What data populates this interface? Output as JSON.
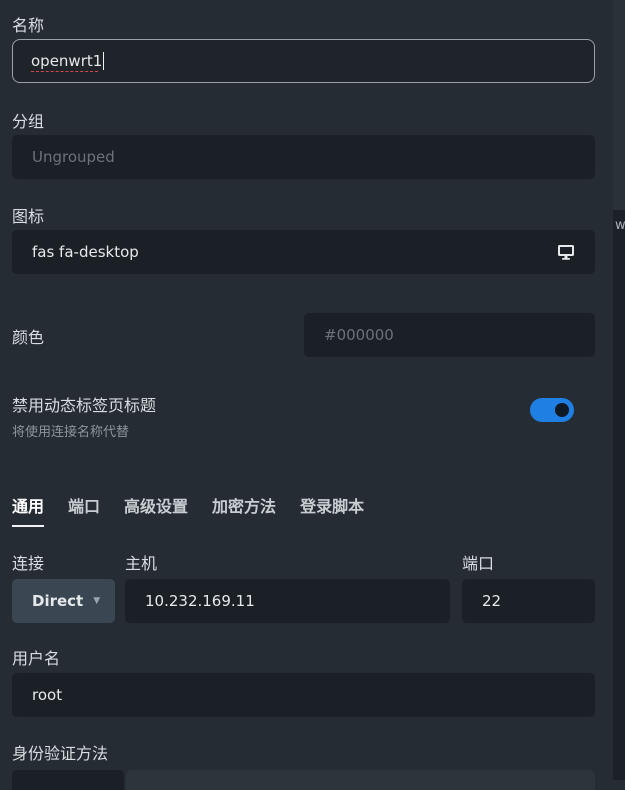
{
  "labels": {
    "name": "名称",
    "group": "分组",
    "icon": "图标",
    "color": "颜色",
    "disable_dynamic_title": "禁用动态标签页标题",
    "disable_dynamic_title_sub": "将使用连接名称代替",
    "connection": "连接",
    "host": "主机",
    "port": "端口",
    "username": "用户名",
    "auth_method": "身份验证方法"
  },
  "fields": {
    "name_value": "openwrt1",
    "group_placeholder": "Ungrouped",
    "icon_value": "fas fa-desktop",
    "color_placeholder": "#000000",
    "connection_value": "Direct",
    "host_value": "10.232.169.11",
    "port_value": "22",
    "username_value": "root"
  },
  "toggle": {
    "disable_dynamic_title": true
  },
  "tabs": [
    {
      "label": "通用",
      "active": true
    },
    {
      "label": "端口",
      "active": false
    },
    {
      "label": "高级设置",
      "active": false
    },
    {
      "label": "加密方法",
      "active": false
    },
    {
      "label": "登录脚本",
      "active": false
    }
  ],
  "edge_fragment": "w",
  "icons": {
    "icon_field": "desktop-monitor-icon",
    "select_caret": "caret-down-icon"
  },
  "colors": {
    "accent": "#1f7fe3",
    "background": "#252c33",
    "field": "#1b2026"
  }
}
